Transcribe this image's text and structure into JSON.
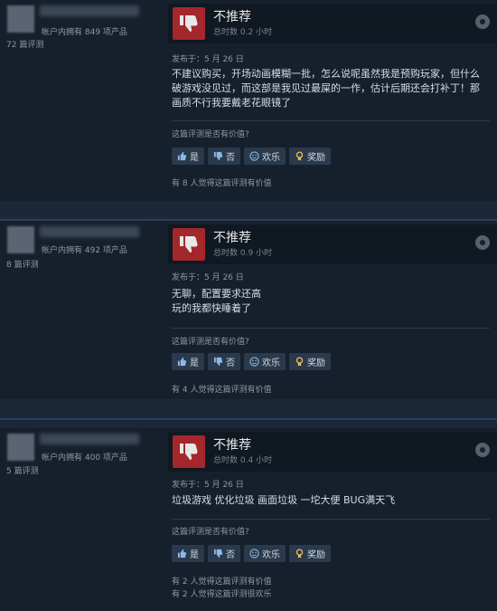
{
  "common": {
    "yes": "是",
    "no": "否",
    "funny": "欢乐",
    "award": "奖励",
    "helpful_q": "这篇评测是否有价值?"
  },
  "reviews": [
    {
      "owned": "帐户内拥有 849 项产品",
      "count": "72 篇评测",
      "verdict": "不推荐",
      "hours": "总时数 0.2 小时",
      "posted": "发布于：5 月 26 日",
      "content": "不建议购买，开场动画模糊一批，怎么说呢虽然我是预购玩家，但什么破游戏没见过，而这部是我见过最屎的一作，估计后期还会打补丁！那画质不行我要戴老花眼镜了",
      "stat1": "有 8 人觉得这篇评测有价值"
    },
    {
      "owned": "帐户内拥有 492 项产品",
      "count": "8 篇评测",
      "verdict": "不推荐",
      "hours": "总时数 0.9 小时",
      "posted": "发布于：5 月 26 日",
      "content_l1": "无聊，配置要求还高",
      "content_l2": "玩的我都快睡着了",
      "stat1": "有 4 人觉得这篇评测有价值"
    },
    {
      "owned": "帐户内拥有 400 项产品",
      "count": "5 篇评测",
      "verdict": "不推荐",
      "hours": "总时数 0.4 小时",
      "posted": "发布于：5 月 26 日",
      "content": "垃圾游戏 优化垃圾 画面垃圾 一坨大便 BUG满天飞",
      "stat1": "有 2 人觉得这篇评测有价值",
      "stat2": "有 2 人觉得这篇评测很欢乐"
    }
  ]
}
